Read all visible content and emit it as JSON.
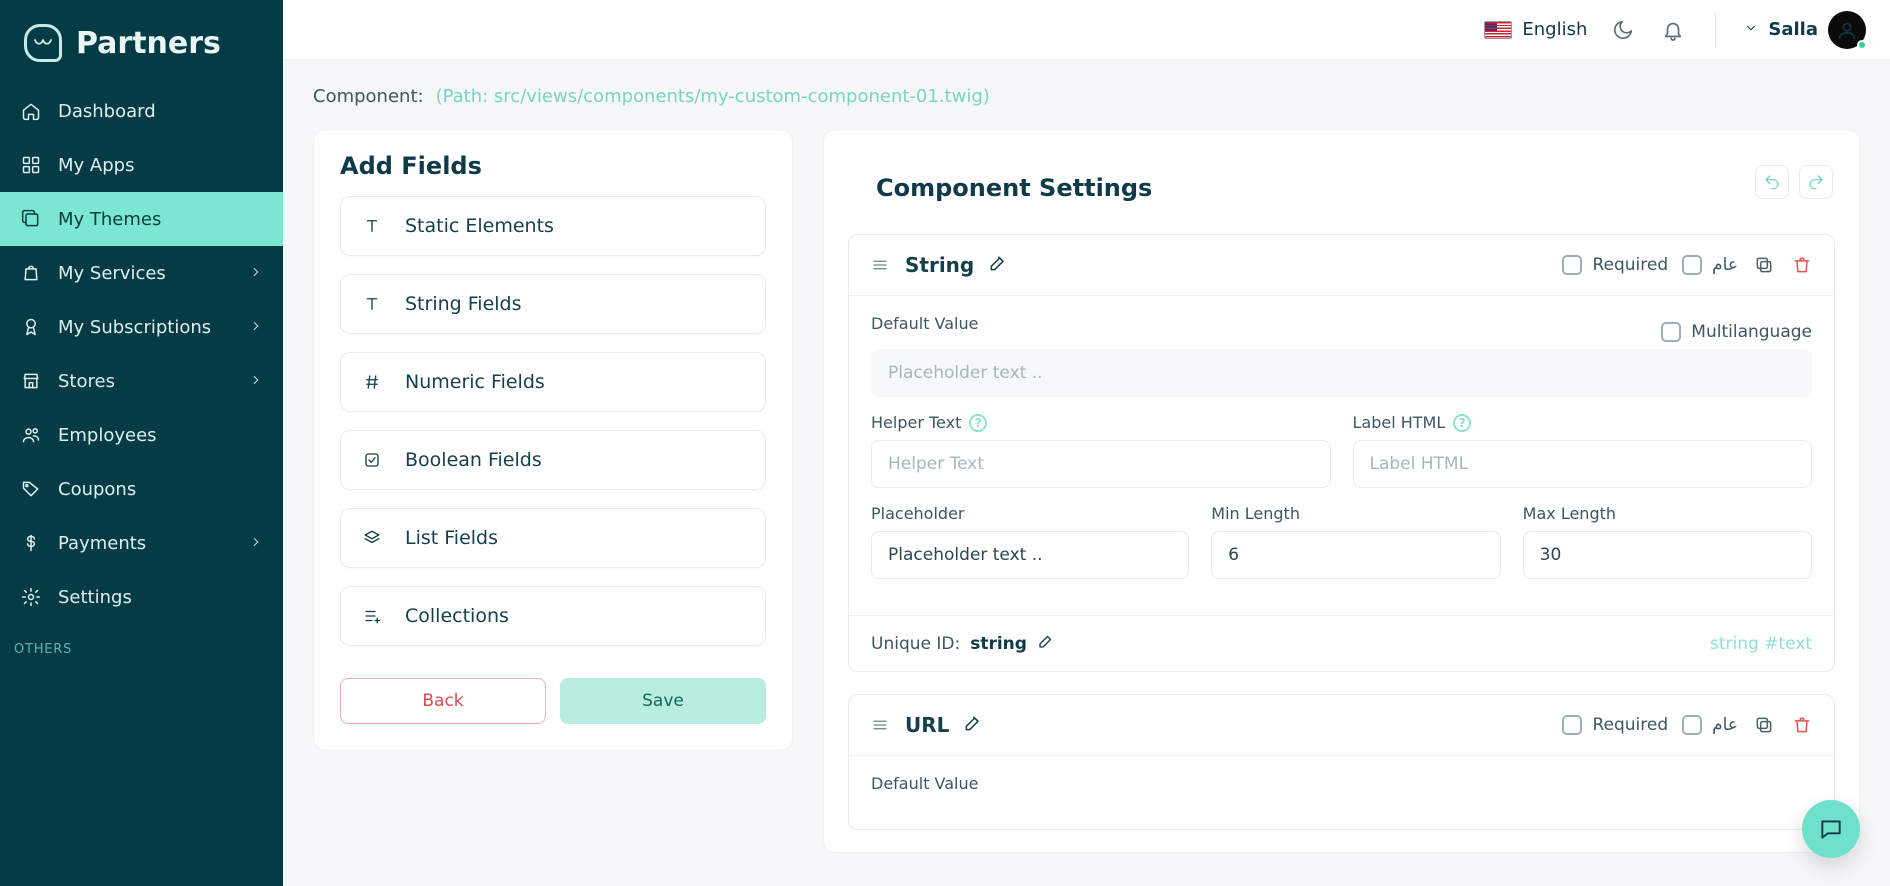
{
  "brand": {
    "title": "Partners"
  },
  "sidebar": {
    "items": [
      {
        "label": "Dashboard",
        "icon": "home",
        "hasSub": false
      },
      {
        "label": "My Apps",
        "icon": "grid",
        "hasSub": false
      },
      {
        "label": "My Themes",
        "icon": "clone",
        "hasSub": false,
        "active": true
      },
      {
        "label": "My Services",
        "icon": "bag",
        "hasSub": true
      },
      {
        "label": "My Subscriptions",
        "icon": "badge",
        "hasSub": true
      },
      {
        "label": "Stores",
        "icon": "store",
        "hasSub": true
      },
      {
        "label": "Employees",
        "icon": "people",
        "hasSub": false
      },
      {
        "label": "Coupons",
        "icon": "tag",
        "hasSub": false
      },
      {
        "label": "Payments",
        "icon": "dollar",
        "hasSub": true
      },
      {
        "label": "Settings",
        "icon": "gear",
        "hasSub": false
      }
    ],
    "others_label": "OTHERS"
  },
  "header": {
    "language": "English",
    "username": "Salla"
  },
  "crumb": {
    "component_label": "Component:",
    "path": "(Path: src/views/components/my-custom-component-01.twig)"
  },
  "addFields": {
    "title": "Add Fields",
    "items": [
      {
        "label": "Static Elements",
        "icon": "T"
      },
      {
        "label": "String Fields",
        "icon": "T"
      },
      {
        "label": "Numeric Fields",
        "icon": "hash"
      },
      {
        "label": "Boolean Fields",
        "icon": "check"
      },
      {
        "label": "List Fields",
        "icon": "stack"
      },
      {
        "label": "Collections",
        "icon": "listplus"
      }
    ],
    "actions": {
      "back": "Back",
      "save": "Save"
    }
  },
  "settings": {
    "title": "Component Settings",
    "required_label": "Required",
    "arabic_label": "عام",
    "multilang_label": "Multilanguage",
    "defaultValue_label": "Default Value",
    "helperText_label": "Helper Text",
    "labelHtml_label": "Label HTML",
    "placeholder_label": "Placeholder",
    "minLength_label": "Min Length",
    "maxLength_label": "Max Length",
    "uniqueId_label": "Unique ID:",
    "placeholders": {
      "defaultValue": "Placeholder text ..",
      "helperText": "Helper Text",
      "labelHtml": "Label HTML"
    },
    "blocks": [
      {
        "title": "String",
        "placeholder_value": "Placeholder text ..",
        "min_length": "6",
        "max_length": "30",
        "unique_id": "string",
        "type_sig": "string #text"
      },
      {
        "title": "URL"
      }
    ]
  }
}
